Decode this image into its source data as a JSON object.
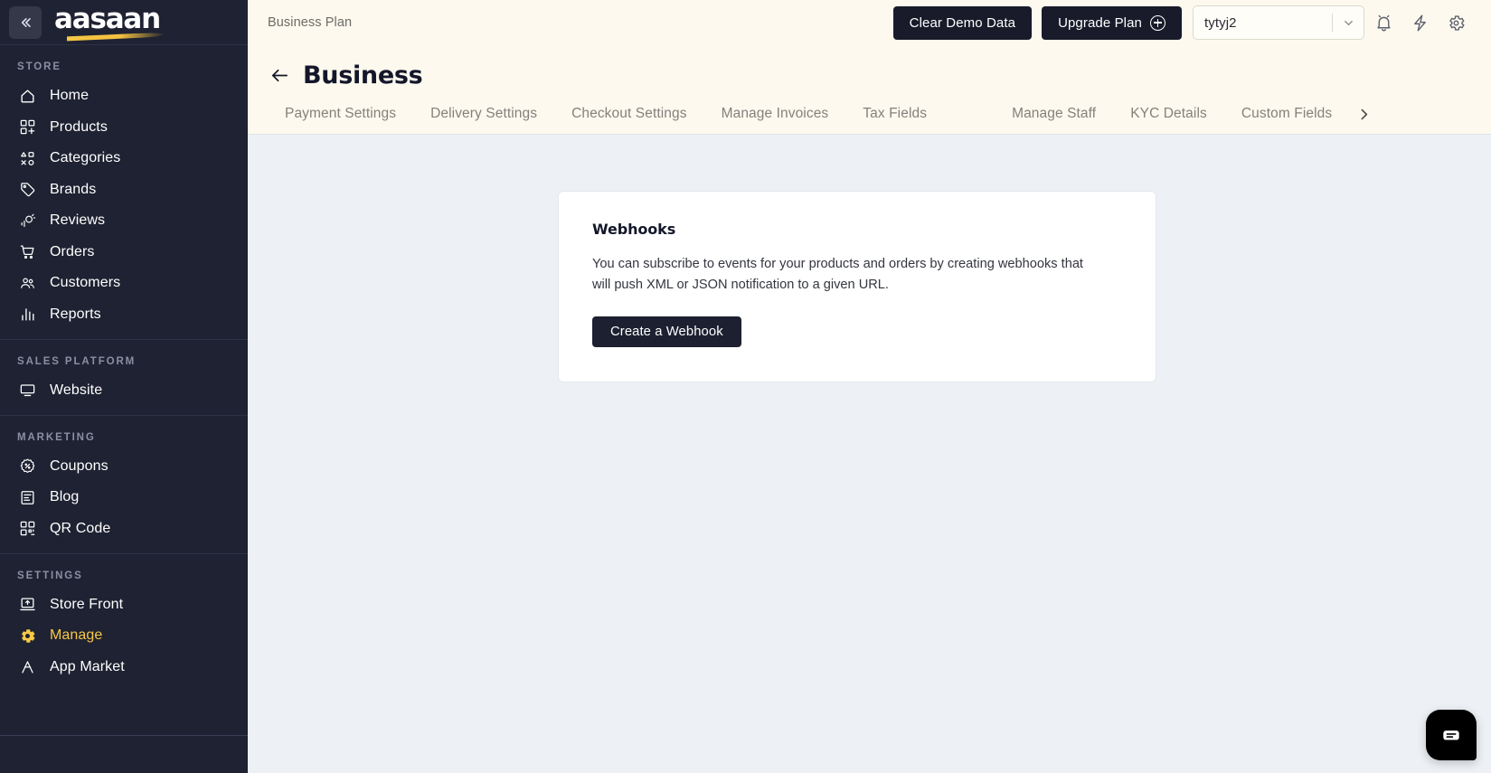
{
  "sidebar": {
    "collapse_icon": "chevrons-left-icon",
    "brand": "aasaan",
    "groups": [
      {
        "label": "STORE",
        "items": [
          {
            "label": "Home",
            "icon": "home-icon",
            "active": false
          },
          {
            "label": "Products",
            "icon": "products-grid-plus-icon",
            "active": false
          },
          {
            "label": "Categories",
            "icon": "categories-shapes-icon",
            "active": false
          },
          {
            "label": "Brands",
            "icon": "tag-icon",
            "active": false
          },
          {
            "label": "Reviews",
            "icon": "reviews-star-icon",
            "active": false
          },
          {
            "label": "Orders",
            "icon": "shopping-cart-icon",
            "active": false
          },
          {
            "label": "Customers",
            "icon": "users-icon",
            "active": false
          },
          {
            "label": "Reports",
            "icon": "bar-chart-icon",
            "active": false
          }
        ]
      },
      {
        "label": "SALES PLATFORM",
        "items": [
          {
            "label": "Website",
            "icon": "monitor-icon",
            "active": false
          }
        ]
      },
      {
        "label": "MARKETING",
        "items": [
          {
            "label": "Coupons",
            "icon": "coupon-percent-icon",
            "active": false
          },
          {
            "label": "Blog",
            "icon": "blog-document-icon",
            "active": false
          },
          {
            "label": "QR Code",
            "icon": "qr-code-icon",
            "active": false
          }
        ]
      },
      {
        "label": "SETTINGS",
        "items": [
          {
            "label": "Store Front",
            "icon": "store-front-icon",
            "active": false
          },
          {
            "label": "Manage",
            "icon": "gear-icon",
            "active": true
          },
          {
            "label": "App Market",
            "icon": "app-market-icon",
            "active": false
          }
        ]
      }
    ]
  },
  "topbar": {
    "plan_label": "Business Plan",
    "clear_demo_label": "Clear Demo Data",
    "upgrade_label": "Upgrade Plan",
    "store_select_value": "tytyj2",
    "notifications_icon": "bell-icon",
    "activity_icon": "lightning-bolt-icon",
    "settings_icon": "gear-icon"
  },
  "page": {
    "back_icon": "arrow-left-icon",
    "title": "Business",
    "tabs": [
      {
        "label": "Payment Settings",
        "active": false
      },
      {
        "label": "Delivery Settings",
        "active": false
      },
      {
        "label": "Checkout Settings",
        "active": false
      },
      {
        "label": "Manage Invoices",
        "active": false
      },
      {
        "label": "Tax Fields",
        "active": false
      },
      {
        "label": "Manage Staff",
        "active": false
      },
      {
        "label": "KYC Details",
        "active": false
      },
      {
        "label": "Custom Fields",
        "active": false
      }
    ],
    "tabs_next_icon": "chevron-right-icon"
  },
  "webhooks_card": {
    "title": "Webhooks",
    "description": "You can subscribe to events for your products and orders by creating webhooks that will push XML or JSON notification to a given URL.",
    "button_label": "Create a Webhook"
  },
  "chat": {
    "icon": "chat-bubble-icon"
  },
  "colors": {
    "sidebar_bg": "#1f2232",
    "accent_yellow": "#f5c846",
    "header_cream": "#fdf9ee",
    "content_bg": "#edf1f5",
    "dark_button": "#191b2a",
    "card_white": "#ffffff"
  }
}
